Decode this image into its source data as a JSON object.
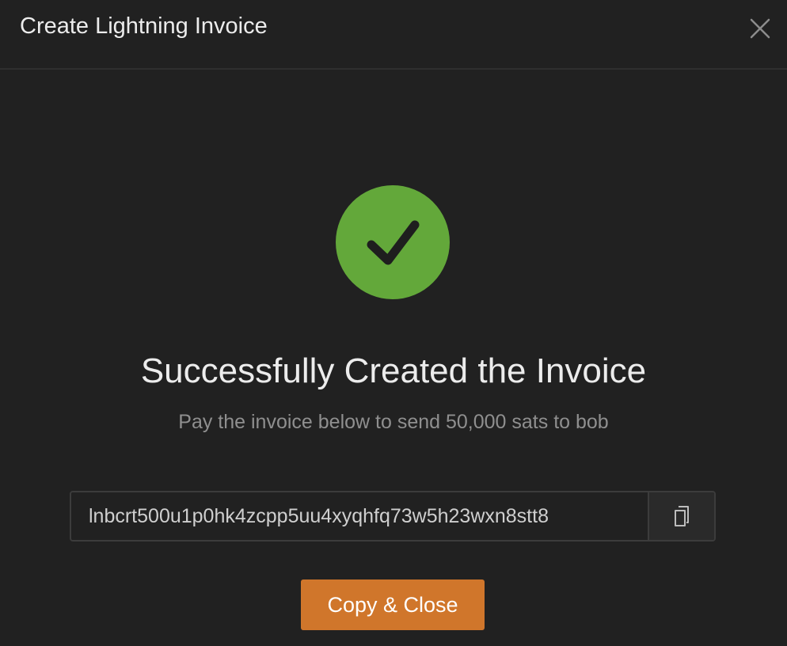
{
  "modal": {
    "title": "Create Lightning Invoice",
    "close_icon": "close-icon"
  },
  "success": {
    "icon": "checkmark-icon",
    "icon_color": "#63a83a",
    "headline": "Successfully Created the Invoice",
    "description": "Pay the invoice below to send 50,000 sats to bob"
  },
  "invoice": {
    "value": "lnbcrt500u1p0hk4zcpp5uu4xyqhfq73w5h23wxn8stt8",
    "copy_icon": "copy-icon"
  },
  "actions": {
    "copy_close_label": "Copy & Close",
    "accent_color": "#d0762b"
  }
}
